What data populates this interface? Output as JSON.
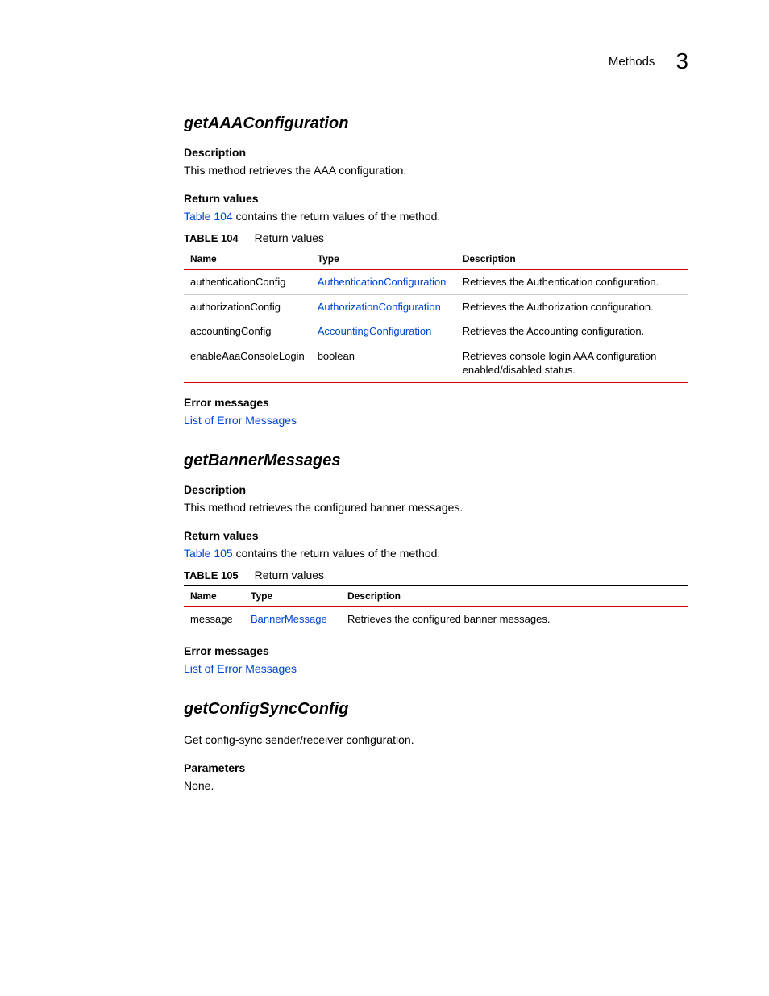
{
  "header": {
    "section": "Methods",
    "chapter": "3"
  },
  "method1": {
    "title": "getAAAConfiguration",
    "desc_heading": "Description",
    "desc_text": "This method retrieves the AAA configuration.",
    "ret_heading": "Return values",
    "ret_link": "Table 104",
    "ret_text": " contains the return values of the method.",
    "table_label": "TABLE 104",
    "table_title": "Return values",
    "th_name": "Name",
    "th_type": "Type",
    "th_desc": "Description",
    "rows": [
      {
        "name": "authenticationConfig",
        "type": "AuthenticationConfiguration",
        "desc": "Retrieves the Authentication configuration."
      },
      {
        "name": "authorizationConfig",
        "type": "AuthorizationConfiguration",
        "desc": "Retrieves the Authorization configuration."
      },
      {
        "name": "accountingConfig",
        "type": "AccountingConfiguration",
        "desc": "Retrieves the Accounting configuration."
      },
      {
        "name": "enableAaaConsoleLogin",
        "type": "boolean",
        "desc": "Retrieves console login AAA configuration enabled/disabled status."
      }
    ],
    "err_heading": "Error messages",
    "err_link": "List of Error Messages"
  },
  "method2": {
    "title": "getBannerMessages",
    "desc_heading": "Description",
    "desc_text": "This method retrieves the configured banner messages.",
    "ret_heading": "Return values",
    "ret_link": "Table 105",
    "ret_text": " contains the return values of the method.",
    "table_label": "TABLE 105",
    "table_title": "Return values",
    "th_name": "Name",
    "th_type": "Type",
    "th_desc": "Description",
    "rows": [
      {
        "name": "message",
        "type": "BannerMessage",
        "desc": "Retrieves the configured banner messages."
      }
    ],
    "err_heading": "Error messages",
    "err_link": "List of Error Messages"
  },
  "method3": {
    "title": "getConfigSyncConfig",
    "desc_text": "Get config-sync sender/receiver configuration.",
    "params_heading": "Parameters",
    "params_text": "None."
  }
}
